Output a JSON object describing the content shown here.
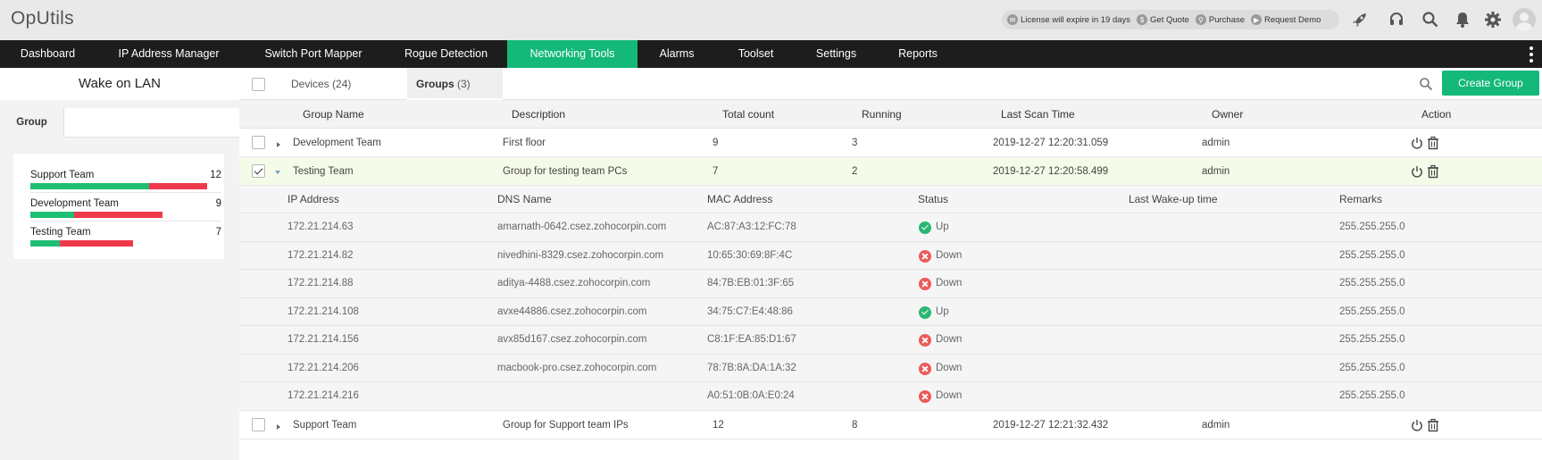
{
  "app": {
    "title": "OpUtils"
  },
  "promo": {
    "license": "License will expire in 19 days",
    "quote": "Get Quote",
    "purchase": "Purchase",
    "demo": "Request Demo"
  },
  "header_icons": [
    "rocket-icon",
    "headset-icon",
    "search-icon",
    "bell-icon",
    "gear-icon",
    "avatar"
  ],
  "nav": {
    "items": [
      "Dashboard",
      "IP Address Manager",
      "Switch Port Mapper",
      "Rogue Detection",
      "Networking Tools",
      "Alarms",
      "Toolset",
      "Settings",
      "Reports"
    ],
    "active": "Networking Tools"
  },
  "sidebar": {
    "title": "Wake on LAN",
    "tab": "Group",
    "groups": [
      {
        "name": "Support Team",
        "count": "12",
        "running_fraction": 0.67
      },
      {
        "name": "Development Team",
        "count": "9",
        "running_fraction": 0.33
      },
      {
        "name": "Testing Team",
        "count": "7",
        "running_fraction": 0.29
      }
    ]
  },
  "tabs": {
    "devices_label": "Devices",
    "devices_count": "(24)",
    "groups_label": "Groups",
    "groups_count": "(3)",
    "create_button": "Create Group"
  },
  "table": {
    "headers": {
      "group_name": "Group Name",
      "description": "Description",
      "total_count": "Total count",
      "running": "Running",
      "last_scan": "Last Scan Time",
      "owner": "Owner",
      "action": "Action"
    },
    "rows": [
      {
        "name": "Development Team",
        "description": "First floor",
        "total": "9",
        "running": "3",
        "last_scan": "2019-12-27 12:20:31.059",
        "owner": "admin"
      },
      {
        "name": "Testing Team",
        "description": "Group for testing team PCs",
        "total": "7",
        "running": "2",
        "last_scan": "2019-12-27 12:20:58.499",
        "owner": "admin"
      },
      {
        "name": "Support Team",
        "description": "Group for Support team IPs",
        "total": "12",
        "running": "8",
        "last_scan": "2019-12-27 12:21:32.432",
        "owner": "admin"
      }
    ]
  },
  "subtable": {
    "headers": {
      "ip": "IP Address",
      "dns": "DNS Name",
      "mac": "MAC Address",
      "status": "Status",
      "wake": "Last Wake-up time",
      "remarks": "Remarks"
    },
    "rows": [
      {
        "ip": "172.21.214.63",
        "dns": "amarnath-0642.csez.zohocorpin.com",
        "mac": "AC:87:A3:12:FC:78",
        "status": "Up",
        "remarks": "255.255.255.0"
      },
      {
        "ip": "172.21.214.82",
        "dns": "nivedhini-8329.csez.zohocorpin.com",
        "mac": "10:65:30:69:8F:4C",
        "status": "Down",
        "remarks": "255.255.255.0"
      },
      {
        "ip": "172.21.214.88",
        "dns": "aditya-4488.csez.zohocorpin.com",
        "mac": "84:7B:EB:01:3F:65",
        "status": "Down",
        "remarks": "255.255.255.0"
      },
      {
        "ip": "172.21.214.108",
        "dns": "avxe44886.csez.zohocorpin.com",
        "mac": "34:75:C7:E4:48:86",
        "status": "Up",
        "remarks": "255.255.255.0"
      },
      {
        "ip": "172.21.214.156",
        "dns": "avx85d167.csez.zohocorpin.com",
        "mac": "C8:1F:EA:85:D1:67",
        "status": "Down",
        "remarks": "255.255.255.0"
      },
      {
        "ip": "172.21.214.206",
        "dns": "macbook-pro.csez.zohocorpin.com",
        "mac": "78:7B:8A:DA:1A:32",
        "status": "Down",
        "remarks": "255.255.255.0"
      },
      {
        "ip": "172.21.214.216",
        "dns": "",
        "mac": "A0:51:0B:0A:E0:24",
        "status": "Down",
        "remarks": "255.255.255.0"
      }
    ]
  },
  "colors": {
    "accent": "#14b879",
    "nav_bg": "#1d1d1d",
    "up": "#2bb673",
    "down": "#ec5a5a",
    "bar_green": "#1fbf73",
    "bar_red": "#f0384b"
  }
}
